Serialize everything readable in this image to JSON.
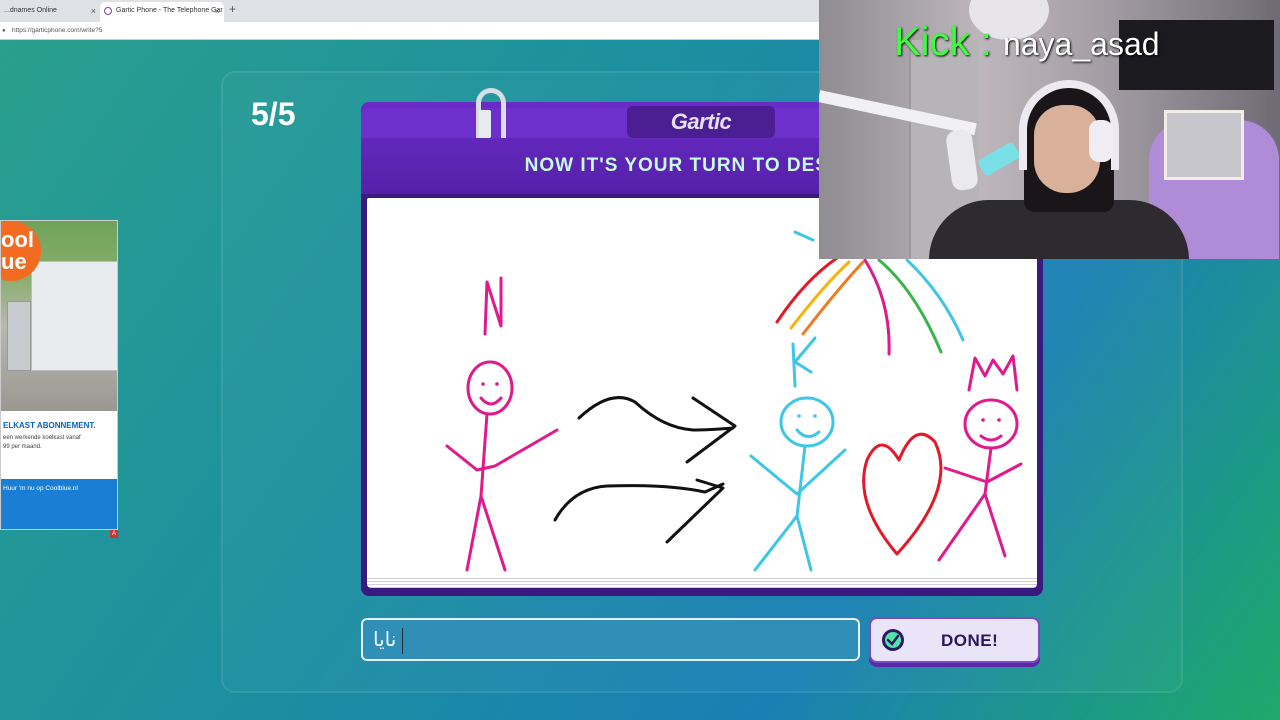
{
  "browser": {
    "tabs": [
      {
        "label": "...dnames Online"
      },
      {
        "label": "Gartic Phone - The Telephone Gar"
      }
    ],
    "close_glyph": "×",
    "new_tab_glyph": "+",
    "url": "https://garticphone.com/write?5"
  },
  "game": {
    "round_counter": "5/5",
    "logo": "Gartic",
    "prompt": "NOW IT'S YOUR TURN TO DESCRIB",
    "input_value": "نايا",
    "done_label": "DONE!"
  },
  "ad": {
    "logo_text": "ool\nue",
    "headline": "ELKAST ABONNEMENT.",
    "subtext": "een werkende koelkast vanaf\n99 per maand.",
    "cta": "Huur 'm nu op Coolblue.nl",
    "badge": "A"
  },
  "stream_overlay": {
    "platform": "Kick",
    "separator": ":",
    "username": "naya_asad"
  },
  "colors": {
    "book_purple": "#5521a9",
    "prompt_text": "#c8fbe3",
    "kick_green": "#3dff3d",
    "pink_ink": "#e0198c",
    "cyan_ink": "#3ec6e6",
    "red_ink": "#e3192a"
  },
  "icons": {
    "done": "check-badge-icon",
    "lock": "lock-icon"
  }
}
